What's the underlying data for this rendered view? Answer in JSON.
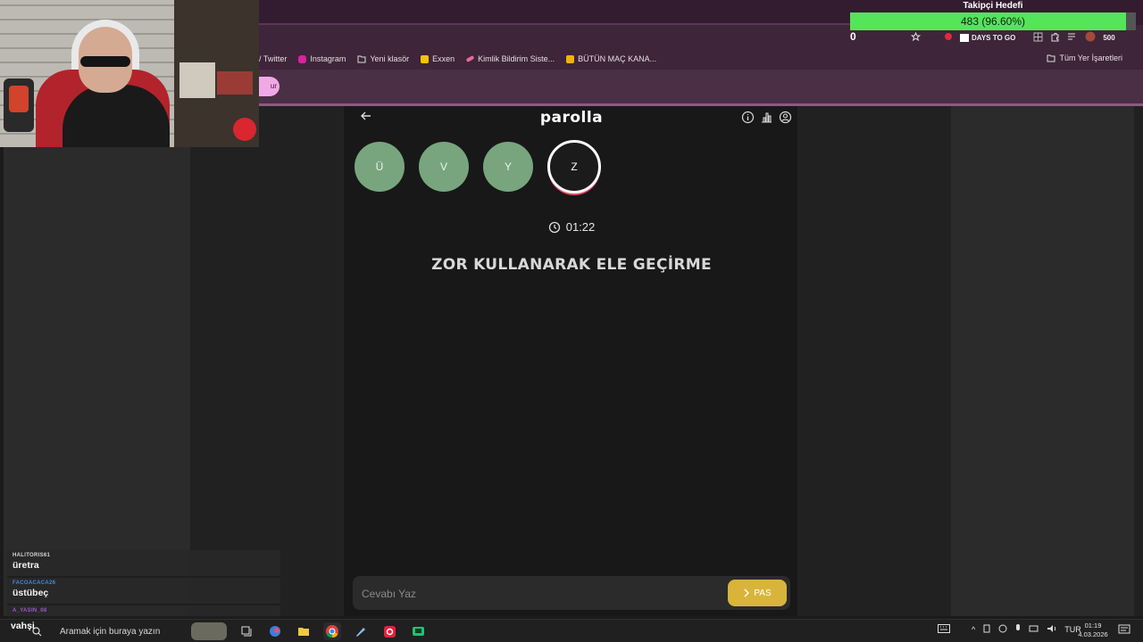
{
  "browser": {
    "bookmarks": [
      {
        "label": "/ Twitter",
        "color": "#1d9bf0"
      },
      {
        "label": "Instagram",
        "color": "#d6249f"
      },
      {
        "label": "Yeni klasör",
        "color": "#c9c9c9"
      },
      {
        "label": "Exxen",
        "color": "#f5c400"
      },
      {
        "label": "Kimlik Bildirim Siste...",
        "color": "#e56b9b"
      },
      {
        "label": "BÜTÜN MAÇ KANA...",
        "color": "#f1b40b"
      }
    ],
    "all_bookmarks": "Tüm Yer İşaretleri",
    "pill_label": "ur",
    "days_to_go": "DAYS TO GO",
    "badge_count": "500"
  },
  "goal": {
    "title": "Takipçi Hedefi",
    "text": "483 (96.60%)",
    "fill": 0.966,
    "counter": "0"
  },
  "app": {
    "title": "parolla",
    "letters": [
      {
        "char": "Ü",
        "state": "done"
      },
      {
        "char": "V",
        "state": "done"
      },
      {
        "char": "Y",
        "state": "done"
      },
      {
        "char": "Z",
        "state": "active"
      }
    ],
    "timer": "01:22",
    "question": "ZOR KULLANARAK ELE GEÇİRME",
    "answer_placeholder": "Cevabı Yaz",
    "pass_label": "PAS",
    "colors": {
      "done": "#78a57e",
      "active_ring": "#e84d64",
      "pass": "#d8b53a"
    }
  },
  "chat": [
    {
      "user": "HALITORIS61",
      "user_color": "#d7d7d7",
      "text": "üretra"
    },
    {
      "user": "FACOACACA26",
      "user_color": "#3f8ae0",
      "text": "üstübeç"
    },
    {
      "user": "A_YASIN_08",
      "user_color": "#9b59d0",
      "text": "vahşi"
    }
  ],
  "taskbar": {
    "search_placeholder": "Aramak için buraya yazın",
    "lang": "TUR",
    "time": "01:19",
    "date": "4.03.2026",
    "notif_count": "3"
  }
}
